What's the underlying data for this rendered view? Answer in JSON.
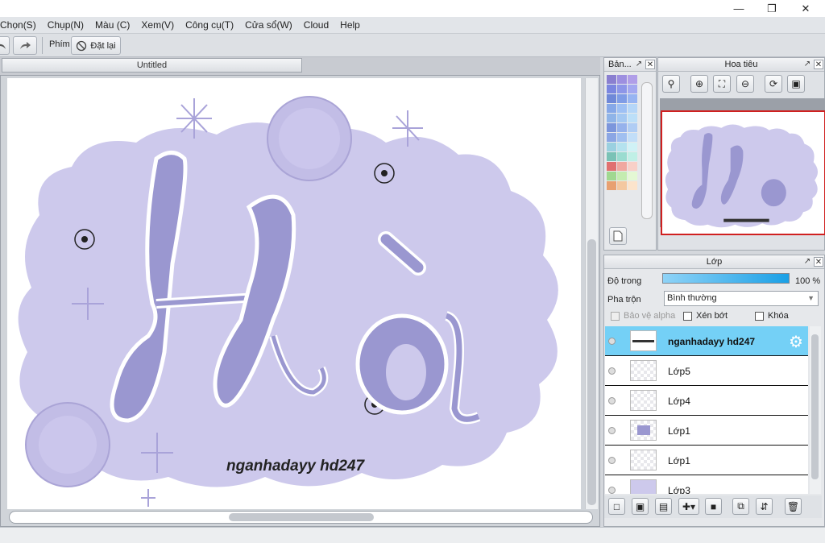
{
  "menu": [
    "Chọn(S)",
    "Chụp(N)",
    "Màu (C)",
    "Xem(V)",
    "Công cụ(T)",
    "Cửa sổ(W)",
    "Cloud",
    "Help"
  ],
  "toolbar": {
    "keys_label": "Phím",
    "reset_label": "Đặt lại"
  },
  "document": {
    "tab_title": "Untitled",
    "artwork_title": "Hà",
    "signature": "nganhadayy hd247"
  },
  "palette_panel": {
    "title": "Bản..."
  },
  "navigator": {
    "title": "Hoa tiêu"
  },
  "layers_panel": {
    "title": "Lớp",
    "opacity_label": "Độ trong",
    "opacity_value": "100 %",
    "opacity_percent": 100,
    "blend_label": "Pha trộn",
    "blend_value": "Bình thường",
    "protect_alpha": "Bảo vệ alpha",
    "clipping": "Xén bớt",
    "lock": "Khóa",
    "layers": [
      {
        "name": "nganhadayy hd247",
        "selected": true
      },
      {
        "name": "Lớp5",
        "selected": false
      },
      {
        "name": "Lớp4",
        "selected": false
      },
      {
        "name": "Lớp1",
        "selected": false
      },
      {
        "name": "Lớp1",
        "selected": false
      },
      {
        "name": "Lớp3",
        "selected": false
      }
    ]
  },
  "colors": {
    "accent": "#74d0f6",
    "canvas_bg": "#cdc9ec",
    "letter": "#9a97d0",
    "nav_border": "#d02020"
  },
  "palette_colors": [
    "#8a7fd0",
    "#9d8fe0",
    "#b09ee8",
    "#7b86e0",
    "#8d96e8",
    "#a3a8f0",
    "#6f88d8",
    "#7f9ce6",
    "#97b4f2",
    "#86a8e8",
    "#9ec0f4",
    "#b5d6f8",
    "#8fb4e8",
    "#a4c8f2",
    "#bcdff8",
    "#7c96dc",
    "#96b2ec",
    "#b0cdf4",
    "#8ba6e4",
    "#a0bff0",
    "#c2def8",
    "#9ad0e0",
    "#b4e2ee",
    "#d0f2f6",
    "#7ac2b6",
    "#9adcd0",
    "#c0f0e6",
    "#e07070",
    "#f0a8a0",
    "#f8d0c8",
    "#a0d890",
    "#c4ec b0",
    "#e4f8d4",
    "#e8a070",
    "#f4c8a0",
    "#fce4cc"
  ]
}
